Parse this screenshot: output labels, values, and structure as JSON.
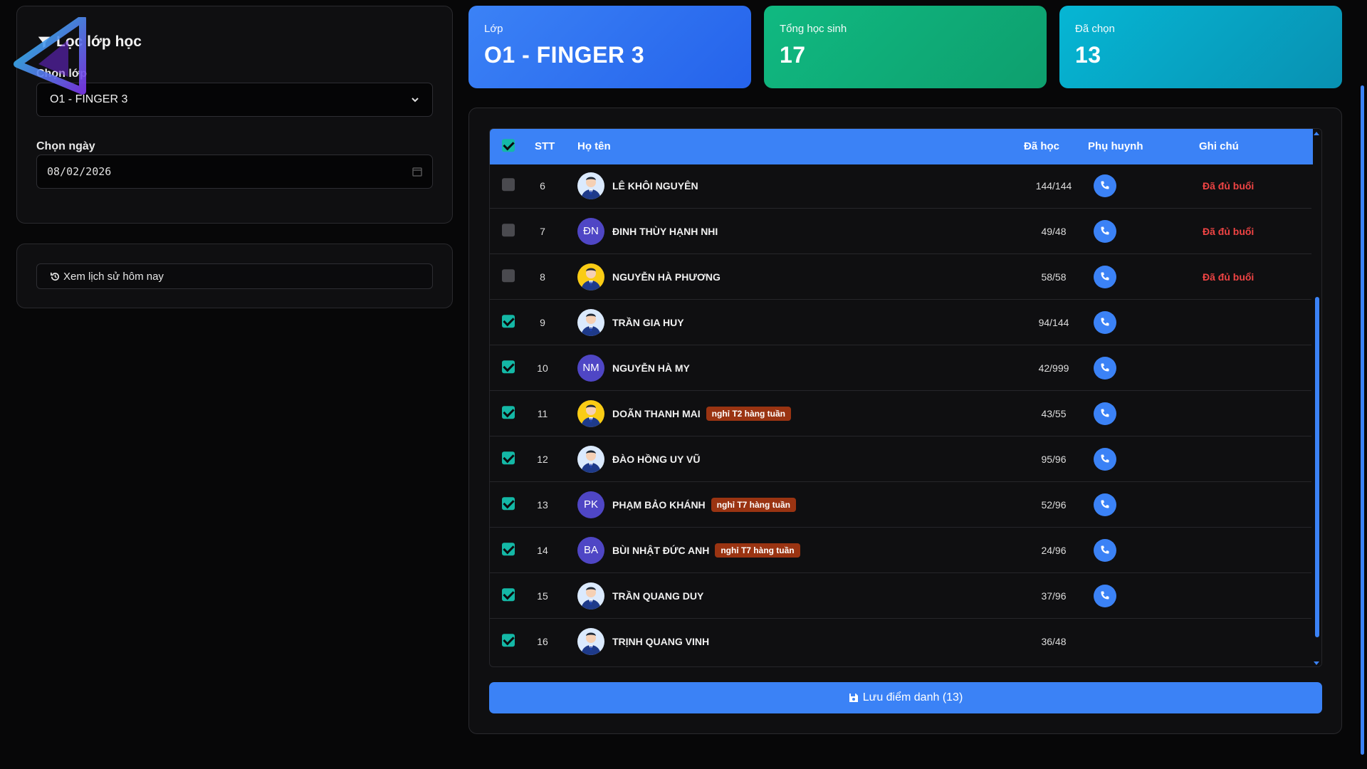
{
  "filter": {
    "title": "Lọc lớp học",
    "class_label": "Chọn lớp",
    "class_value": "O1 - FINGER 3",
    "date_label": "Chọn ngày",
    "date_value": "08/02/2026"
  },
  "history": {
    "button_label": "Xem lịch sử hôm nay"
  },
  "stats": {
    "class": {
      "label": "Lớp",
      "value": "O1 - FINGER 3"
    },
    "total": {
      "label": "Tổng học sinh",
      "value": "17"
    },
    "selected": {
      "label": "Đã chọn",
      "value": "13"
    }
  },
  "table": {
    "headers": {
      "stt": "STT",
      "name": "Họ tên",
      "attended": "Đã học",
      "parent": "Phụ huynh",
      "note": "Ghi chú"
    },
    "rows": [
      {
        "stt": "6",
        "name": "LÊ KHÔI NGUYÊN",
        "avatar": "photo",
        "initials": "",
        "tag": "",
        "attended": "144/144",
        "checked": false,
        "note": "Đã đủ buổi"
      },
      {
        "stt": "7",
        "name": "ĐINH THÙY HẠNH NHI",
        "avatar": "initials",
        "initials": "ĐN",
        "tag": "",
        "attended": "49/48",
        "checked": false,
        "note": "Đã đủ buổi"
      },
      {
        "stt": "8",
        "name": "NGUYỄN HÀ PHƯƠNG",
        "avatar": "photo-gold",
        "initials": "",
        "tag": "",
        "attended": "58/58",
        "checked": false,
        "note": "Đã đủ buổi"
      },
      {
        "stt": "9",
        "name": "TRẦN GIA HUY",
        "avatar": "photo",
        "initials": "",
        "tag": "",
        "attended": "94/144",
        "checked": true,
        "note": ""
      },
      {
        "stt": "10",
        "name": "NGUYỄN HÀ MY",
        "avatar": "initials",
        "initials": "NM",
        "tag": "",
        "attended": "42/999",
        "checked": true,
        "note": ""
      },
      {
        "stt": "11",
        "name": "DOÃN THANH MAI",
        "avatar": "photo-gold",
        "initials": "",
        "tag": "nghỉ T2 hàng tuần",
        "attended": "43/55",
        "checked": true,
        "note": ""
      },
      {
        "stt": "12",
        "name": "ĐÀO HỒNG UY VŨ",
        "avatar": "photo",
        "initials": "",
        "tag": "",
        "attended": "95/96",
        "checked": true,
        "note": ""
      },
      {
        "stt": "13",
        "name": "PHẠM BẢO KHÁNH",
        "avatar": "initials",
        "initials": "PK",
        "tag": "nghỉ T7 hàng tuần",
        "attended": "52/96",
        "checked": true,
        "note": ""
      },
      {
        "stt": "14",
        "name": "BÙI NHẬT ĐỨC ANH",
        "avatar": "initials",
        "initials": "BA",
        "tag": "nghỉ T7 hàng tuần",
        "attended": "24/96",
        "checked": true,
        "note": ""
      },
      {
        "stt": "15",
        "name": "TRẦN QUANG DUY",
        "avatar": "photo",
        "initials": "",
        "tag": "",
        "attended": "37/96",
        "checked": true,
        "note": ""
      },
      {
        "stt": "16",
        "name": "TRỊNH QUANG VINH",
        "avatar": "photo",
        "initials": "",
        "tag": "",
        "attended": "36/48",
        "checked": true,
        "note": ""
      }
    ]
  },
  "save": {
    "label": "Lưu điểm danh (13)"
  },
  "icons": {
    "filter": "filter-icon",
    "history": "history-icon",
    "phone": "phone-icon",
    "save": "floppy-disk-icon",
    "calendar": "calendar-icon",
    "chevron": "chevron-down-icon"
  },
  "colors": {
    "accent": "#3b82f6",
    "green": "#10b981",
    "cyan": "#06b6d4",
    "danger": "#ef4444",
    "tag": "#9a3412",
    "check": "#14b8a6"
  }
}
